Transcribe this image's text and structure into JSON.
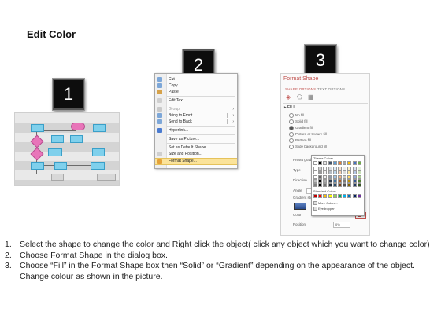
{
  "title": "Edit Color",
  "badges": [
    "1",
    "2",
    "3"
  ],
  "menu": {
    "items": [
      {
        "label": "Cut",
        "disabled": false,
        "submenu": false
      },
      {
        "label": "Copy",
        "disabled": false,
        "submenu": false
      },
      {
        "label": "Paste",
        "disabled": false,
        "submenu": false
      },
      {
        "label": "Edit Text",
        "disabled": false,
        "submenu": false
      },
      {
        "label": "Group",
        "disabled": true,
        "submenu": true
      },
      {
        "label": "Bring to Front",
        "disabled": false,
        "submenu": true
      },
      {
        "label": "Send to Back",
        "disabled": false,
        "submenu": true
      },
      {
        "label": "Hyperlink...",
        "disabled": false,
        "submenu": false
      },
      {
        "label": "Save as Picture...",
        "disabled": false,
        "submenu": false
      },
      {
        "label": "Set as Default Shape",
        "disabled": false,
        "submenu": false
      },
      {
        "label": "Size and Position...",
        "disabled": false,
        "submenu": false
      },
      {
        "label": "Format Shape...",
        "disabled": false,
        "submenu": false,
        "highlighted": true
      }
    ]
  },
  "pane": {
    "title": "Format Shape",
    "tab_shape": "SHAPE OPTIONS",
    "tab_text": "TEXT OPTIONS",
    "section": "▸ FILL",
    "options": [
      "No fill",
      "Solid fill",
      "Gradient fill",
      "Picture or texture fill",
      "Pattern fill",
      "Slide background fill"
    ],
    "selected_option": "Gradient fill",
    "fields": [
      "Preset gradi",
      "Type",
      "Direction",
      "Angle",
      "Gradient sto"
    ],
    "color_label": "Color",
    "position_label": "Position",
    "position_value": "0%"
  },
  "palette": {
    "theme_label": "Theme Colors",
    "standard_label": "Standard Colors",
    "more_colors": "More Colors...",
    "eyedropper": "Eyedropper",
    "theme_top": [
      "#ffffff",
      "#000000",
      "#e7e6e6",
      "#44546a",
      "#5b9bd5",
      "#ed7d31",
      "#a5a5a5",
      "#ffc000",
      "#4472c4",
      "#70ad47"
    ],
    "standard": [
      "#c00000",
      "#ff0000",
      "#ffc000",
      "#ffff00",
      "#92d050",
      "#00b050",
      "#00b0f0",
      "#0070c0",
      "#002060",
      "#7030a0"
    ]
  },
  "steps": [
    {
      "num": "1.",
      "text": "Select the shape to change the color and Right click the object( click any object which you want to change color)"
    },
    {
      "num": "2.",
      "text": "Choose Format Shape in the dialog box."
    },
    {
      "num": "3.",
      "text": "Choose “Fill” in the Format Shape box then “Solid” or “Gradient” depending on the appearance of the object. Change colour as shown in the picture."
    }
  ]
}
